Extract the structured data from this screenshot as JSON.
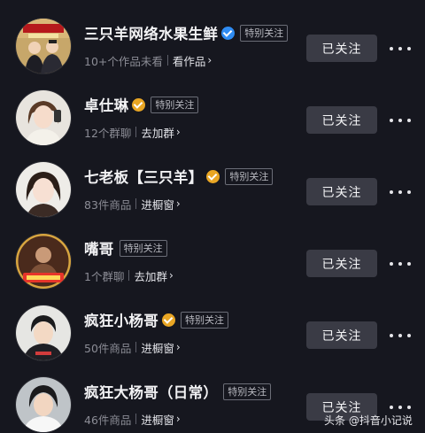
{
  "list": [
    {
      "name": "三只羊网络水果生鲜",
      "badge": "blue",
      "tag": "特别关注",
      "stat": "10+个作品未看",
      "link": "看作品",
      "follow_label": "已关注"
    },
    {
      "name": "卓仕琳",
      "badge": "gold",
      "tag": "特别关注",
      "stat": "12个群聊",
      "link": "去加群",
      "follow_label": "已关注"
    },
    {
      "name": "七老板【三只羊】",
      "badge": "gold",
      "tag": "特别关注",
      "stat": "83件商品",
      "link": "进橱窗",
      "follow_label": "已关注"
    },
    {
      "name": "嘴哥",
      "badge": null,
      "tag": "特别关注",
      "stat": "1个群聊",
      "link": "去加群",
      "follow_label": "已关注"
    },
    {
      "name": "疯狂小杨哥",
      "badge": "gold",
      "tag": "特别关注",
      "stat": "50件商品",
      "link": "进橱窗",
      "follow_label": "已关注"
    },
    {
      "name": "疯狂大杨哥（日常）",
      "badge": null,
      "tag": "特别关注",
      "stat": "46件商品",
      "link": "进橱窗",
      "follow_label": "已关注"
    }
  ],
  "icons": {
    "blue_badge": "verified-blue-icon",
    "gold_badge": "verified-gold-icon",
    "chevron": "chevron-right-icon",
    "more": "more-options-icon"
  },
  "colors": {
    "background": "#16171f",
    "button": "#3a3b45",
    "badge_blue": "#2f8cf3",
    "badge_gold": "#e9a624"
  },
  "watermark": {
    "text": "头条 @抖音小记说"
  }
}
